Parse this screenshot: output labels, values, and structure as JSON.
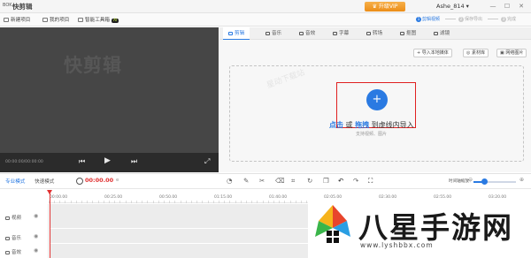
{
  "app": {
    "logo": "BOK",
    "title": "快剪辑",
    "vip_label": "升级VIP",
    "username": "Ashe_814"
  },
  "window_controls": [
    "—",
    "☐",
    "✕"
  ],
  "toolbar": {
    "new_project": "新建项目",
    "my_projects": "我的项目",
    "smart_tools": "智能工具箱",
    "ai_badge": "AI"
  },
  "steps": [
    {
      "num": "1",
      "label": "剪辑视频",
      "active": true
    },
    {
      "num": "2",
      "label": "保存导出"
    },
    {
      "num": "3",
      "label": "完成"
    }
  ],
  "preview": {
    "watermark": "快剪辑",
    "timecode": "00:00:00/00:00:00"
  },
  "tabs": [
    {
      "label": "剪辑",
      "icon": "film-icon",
      "active": true
    },
    {
      "label": "音乐",
      "icon": "music-icon"
    },
    {
      "label": "音效",
      "icon": "sound-icon"
    },
    {
      "label": "字幕",
      "icon": "text-icon"
    },
    {
      "label": "转场",
      "icon": "transition-icon"
    },
    {
      "label": "抠图",
      "icon": "cutout-icon"
    },
    {
      "label": "滤镜",
      "icon": "filter-icon"
    }
  ],
  "media_buttons": {
    "import_local": "+ 导入本地媒体",
    "material_lib": "素材库",
    "web_image": "网络图片"
  },
  "dropzone": {
    "watermark": "星动下载站",
    "plus": "+",
    "hint_click": "点击",
    "hint_or": " 或 ",
    "hint_drag": "拖拽",
    "hint_rest": " 到虚线内导入",
    "sub": "支持视频、图片"
  },
  "timeline": {
    "mode_pro": "专业模式",
    "mode_fast": "快速模式",
    "time_now": "00:00.00",
    "time_unit": "e",
    "zoom_label": "时间轴缩放：",
    "zoom_level": 0.25,
    "ticks": [
      "00:00.00",
      "00:25.00",
      "00:50.00",
      "01:15.00",
      "01:40.00",
      "02:05.00",
      "02:30.00",
      "02:55.00",
      "03:20.00"
    ],
    "tracks": [
      {
        "label": "视频",
        "icon": "video-track-icon"
      },
      {
        "label": "音乐",
        "icon": "music-track-icon"
      },
      {
        "label": "音效",
        "icon": "sound-track-icon"
      }
    ]
  },
  "site_logo": {
    "text": "八星手游网",
    "url": "www.lyshbbx.com"
  }
}
